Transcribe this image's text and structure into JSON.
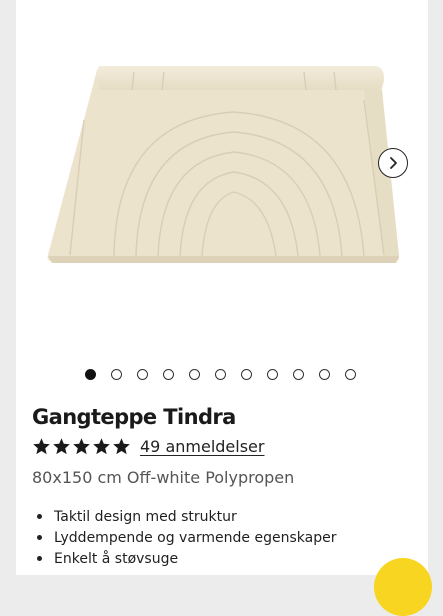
{
  "product": {
    "title": "Gangteppe Tindra",
    "rating_value": 5,
    "reviews_label": "49 anmeldelser",
    "subtitle": "80x150 cm Off-white Polypropen",
    "features": [
      "Taktil design med struktur",
      "Lyddempende og varmende egenskaper",
      "Enkelt å støvsuge"
    ]
  },
  "gallery": {
    "image_count": 11,
    "active_index": 0
  },
  "colors": {
    "rug": "#ede4cf",
    "star": "#1a1a1a",
    "badge": "#f7d520"
  },
  "icons": {
    "next": "chevron-right-icon",
    "star": "star-icon"
  }
}
